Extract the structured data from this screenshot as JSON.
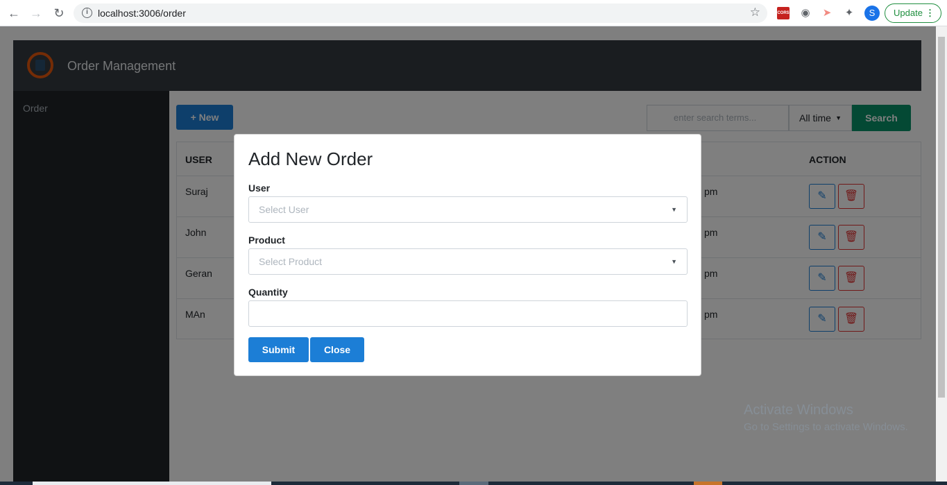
{
  "browser": {
    "url": "localhost:3006/order",
    "avatar_letter": "S",
    "update_label": "Update",
    "ext_cors_label": "CORS"
  },
  "app": {
    "title": "Order Management",
    "sidebar_items": [
      "Order"
    ]
  },
  "toolbar": {
    "new_label": "+ New",
    "search_placeholder": "enter search terms...",
    "time_filter": "All time",
    "search_label": "Search"
  },
  "table": {
    "headers": {
      "user": "USER",
      "action": "ACTION"
    },
    "rows": [
      {
        "user": "Suraj",
        "time": "pm"
      },
      {
        "user": "John",
        "time": "pm"
      },
      {
        "user": "Geran",
        "time": "pm"
      },
      {
        "user": "MAn",
        "time": "pm"
      }
    ]
  },
  "modal": {
    "title": "Add New Order",
    "user_label": "User",
    "user_placeholder": "Select User",
    "product_label": "Product",
    "product_placeholder": "Select Product",
    "quantity_label": "Quantity",
    "quantity_value": "",
    "submit_label": "Submit",
    "close_label": "Close"
  },
  "watermark": {
    "line1": "Activate Windows",
    "line2": "Go to Settings to activate Windows."
  },
  "colors": {
    "primary": "#1c7ed6",
    "search_green": "#099268",
    "danger": "#e03131",
    "header_dark": "#343a40"
  }
}
